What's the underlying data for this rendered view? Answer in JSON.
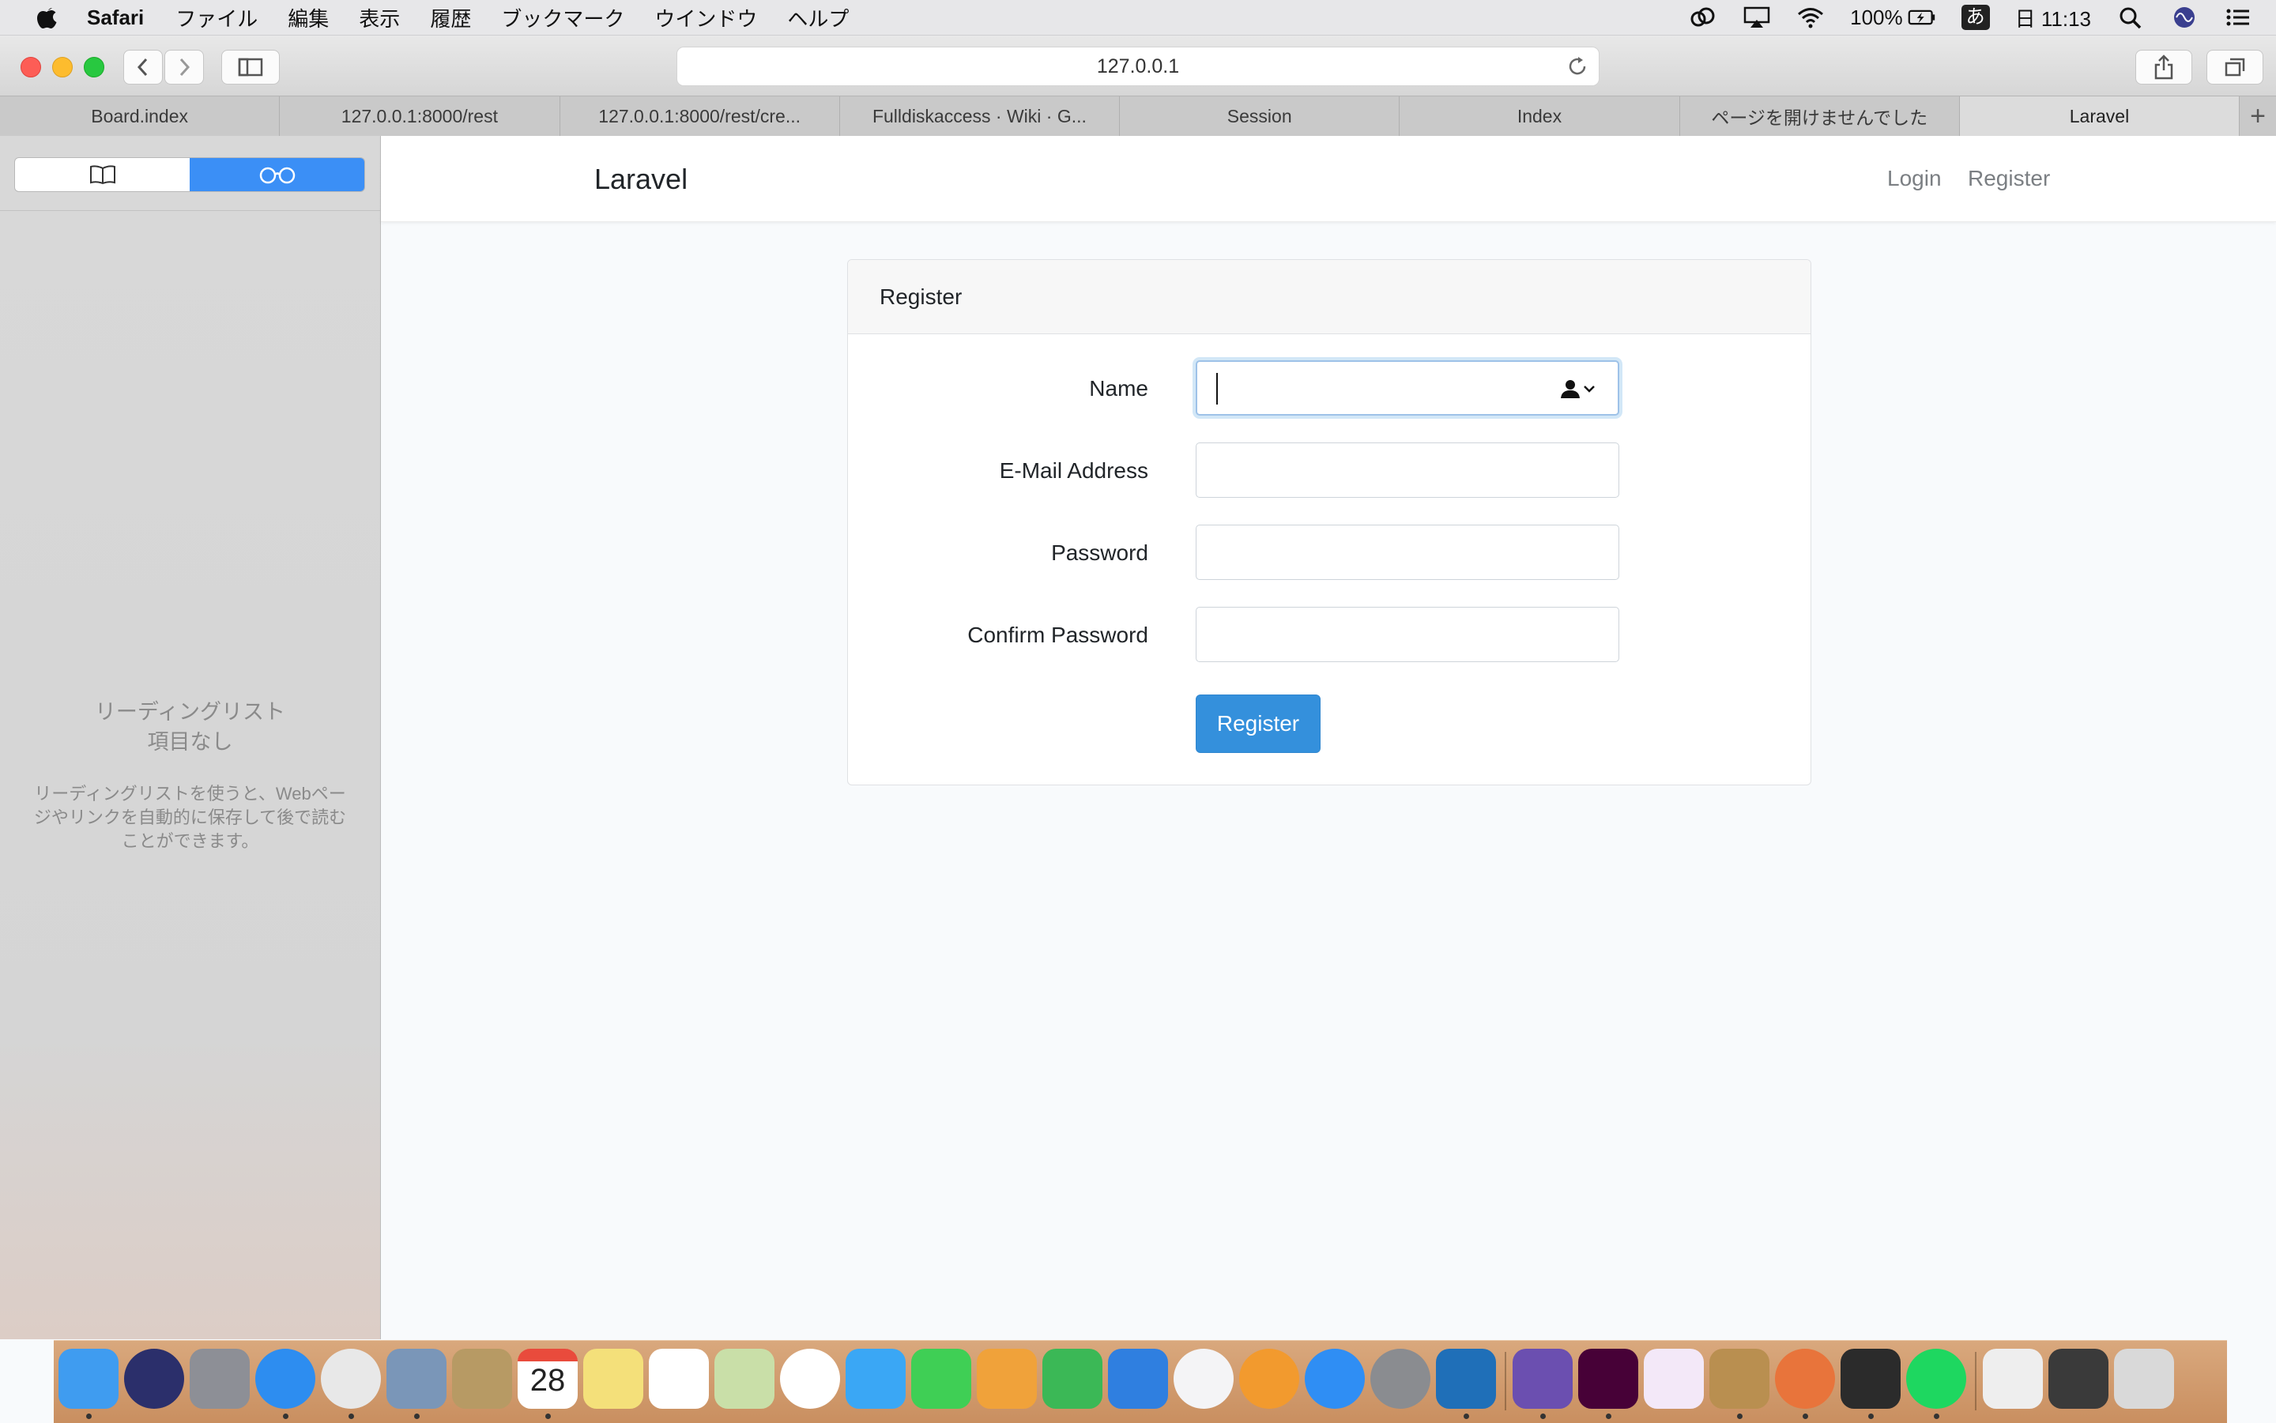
{
  "menubar": {
    "app_name": "Safari",
    "items": [
      "ファイル",
      "編集",
      "表示",
      "履歴",
      "ブックマーク",
      "ウインドウ",
      "ヘルプ"
    ],
    "battery": "100%",
    "input_method": "あ",
    "clock": "日 11:13"
  },
  "toolbar": {
    "url": "127.0.0.1"
  },
  "tabs": [
    {
      "label": "Board.index",
      "active": false
    },
    {
      "label": "127.0.0.1:8000/rest",
      "active": false
    },
    {
      "label": "127.0.0.1:8000/rest/cre...",
      "active": false
    },
    {
      "label": "Fulldiskaccess · Wiki · G...",
      "active": false
    },
    {
      "label": "Session",
      "active": false
    },
    {
      "label": "Index",
      "active": false
    },
    {
      "label": "ページを開けませんでした",
      "active": false
    },
    {
      "label": "Laravel",
      "active": true
    }
  ],
  "sidebar": {
    "title_line1": "リーディングリスト",
    "title_line2": "項目なし",
    "description": "リーディングリストを使うと、Webページやリンクを自動的に保存して後で読むことができます。"
  },
  "site": {
    "brand": "Laravel",
    "nav_login": "Login",
    "nav_register": "Register"
  },
  "form": {
    "card_title": "Register",
    "name_label": "Name",
    "email_label": "E-Mail Address",
    "password_label": "Password",
    "confirm_label": "Confirm Password",
    "name_value": "",
    "email_value": "",
    "password_value": "",
    "confirm_value": "",
    "submit_label": "Register"
  },
  "dock": {
    "calendar_day": "28",
    "apps": [
      "finder-icon",
      "siri-icon",
      "launchpad-icon",
      "safari-icon",
      "chrome-icon",
      "preview-icon",
      "contacts-icon",
      "calendar-icon",
      "notes-icon",
      "reminders-icon",
      "maps-icon",
      "photos-icon",
      "messages-icon",
      "facetime-icon",
      "pages-icon",
      "numbers-icon",
      "keynote-icon",
      "music-icon",
      "books-icon",
      "app-store-icon",
      "system-preferences-icon",
      "vscode-icon",
      "visual-studio-icon",
      "adobe-xd-icon",
      "app-icon",
      "instruments-icon",
      "keyboard-app-icon",
      "terminal-icon",
      "spotify-icon",
      "archive-icon",
      "device-icon",
      "trash-icon"
    ]
  }
}
